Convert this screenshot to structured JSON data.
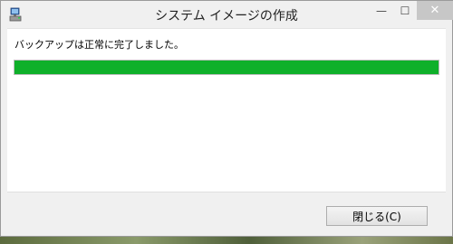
{
  "window": {
    "title": "システム イメージの作成",
    "controls": {
      "minimize": "—",
      "maximize": "☐",
      "close": "✕"
    }
  },
  "main": {
    "message": "バックアップは正常に完了しました。",
    "progress": {
      "percent": 100,
      "color": "#0fb02a"
    }
  },
  "footer": {
    "close_label": "閉じる(C)"
  }
}
